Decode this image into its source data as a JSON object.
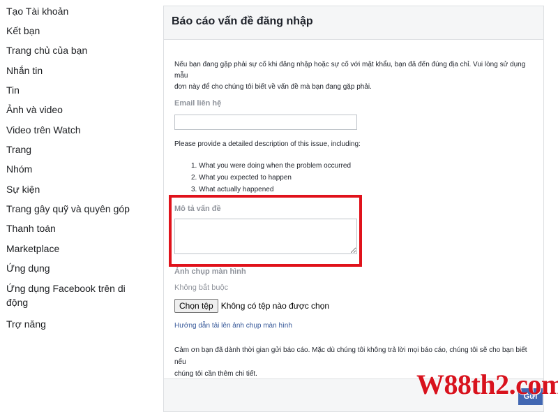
{
  "sidebar": {
    "items": [
      {
        "label": "Tạo Tài khoản"
      },
      {
        "label": "Kết bạn"
      },
      {
        "label": "Trang chủ của bạn"
      },
      {
        "label": "Nhắn tin"
      },
      {
        "label": "Tin"
      },
      {
        "label": "Ảnh và video"
      },
      {
        "label": "Video trên Watch"
      },
      {
        "label": "Trang"
      },
      {
        "label": "Nhóm"
      },
      {
        "label": "Sự kiện"
      },
      {
        "label": "Trang gây quỹ và quyên góp"
      },
      {
        "label": "Thanh toán"
      },
      {
        "label": "Marketplace"
      },
      {
        "label": "Ứng dụng"
      },
      {
        "label": "Ứng dụng Facebook trên di",
        "label2": "động"
      },
      {
        "label": "Trợ năng"
      }
    ]
  },
  "form": {
    "title": "Báo cáo vấn đề đăng nhập",
    "intro_line1": "Nếu bạn đang gặp phải sự cố khi đăng nhập hoặc sự cố với mật khẩu, bạn đã đến đúng địa chỉ. Vui lòng sử dụng mẫu",
    "intro_line2": "đơn này để cho chúng tôi biết về vấn đề mà bạn đang gặp phải.",
    "email_label": "Email liên hệ",
    "email_value": "",
    "description_prompt": "Please provide a detailed description of this issue, including:",
    "steps": [
      "1. What you were doing when the problem occurred",
      "2. What you expected to happen",
      "3. What actually happened"
    ],
    "description_label": "Mô tả vấn đề",
    "description_value": "",
    "screenshot_label": "Ảnh chụp màn hình",
    "optional_text": "Không bắt buộc",
    "file_button_label": "Chọn tệp",
    "file_status": "Không có tệp nào được chọn",
    "guide_link": "Hướng dẫn tải lên ảnh chụp màn hình",
    "thanks_line1": "Cảm ơn bạn đã dành thời gian gửi báo cáo. Mặc dù chúng tôi không trả lời mọi báo cáo, chúng tôi sẽ cho bạn biết nếu",
    "thanks_line2": "chúng tôi cần thêm chi tiết.",
    "submit_label": "Gửi"
  },
  "watermark": "W88th2.com",
  "colors": {
    "link": "#365899",
    "submit": "#4267b2",
    "highlight": "#e0121b",
    "watermark": "#d8121d"
  }
}
